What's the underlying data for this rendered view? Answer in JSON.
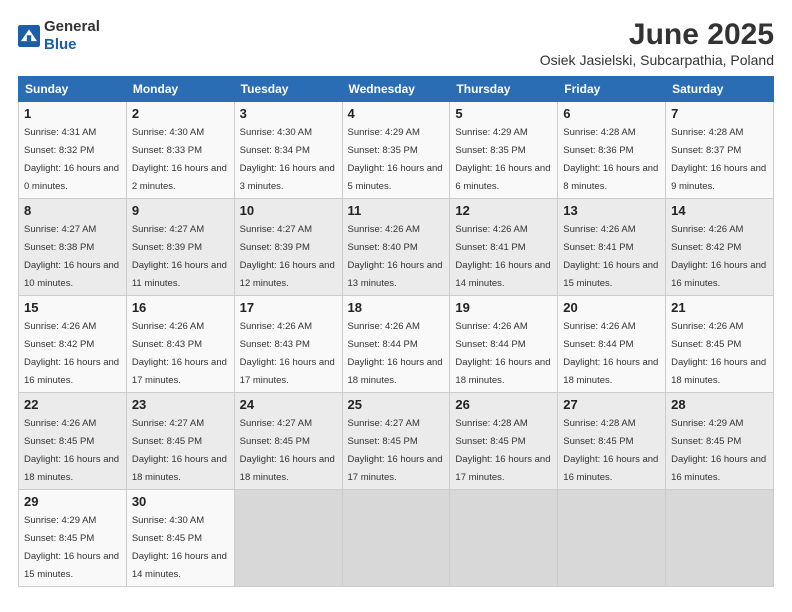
{
  "logo": {
    "general": "General",
    "blue": "Blue"
  },
  "title": "June 2025",
  "subtitle": "Osiek Jasielski, Subcarpathia, Poland",
  "days_header": [
    "Sunday",
    "Monday",
    "Tuesday",
    "Wednesday",
    "Thursday",
    "Friday",
    "Saturday"
  ],
  "weeks": [
    [
      {
        "day": "1",
        "sunrise": "4:31 AM",
        "sunset": "8:32 PM",
        "daylight": "16 hours and 0 minutes."
      },
      {
        "day": "2",
        "sunrise": "4:30 AM",
        "sunset": "8:33 PM",
        "daylight": "16 hours and 2 minutes."
      },
      {
        "day": "3",
        "sunrise": "4:30 AM",
        "sunset": "8:34 PM",
        "daylight": "16 hours and 3 minutes."
      },
      {
        "day": "4",
        "sunrise": "4:29 AM",
        "sunset": "8:35 PM",
        "daylight": "16 hours and 5 minutes."
      },
      {
        "day": "5",
        "sunrise": "4:29 AM",
        "sunset": "8:35 PM",
        "daylight": "16 hours and 6 minutes."
      },
      {
        "day": "6",
        "sunrise": "4:28 AM",
        "sunset": "8:36 PM",
        "daylight": "16 hours and 8 minutes."
      },
      {
        "day": "7",
        "sunrise": "4:28 AM",
        "sunset": "8:37 PM",
        "daylight": "16 hours and 9 minutes."
      }
    ],
    [
      {
        "day": "8",
        "sunrise": "4:27 AM",
        "sunset": "8:38 PM",
        "daylight": "16 hours and 10 minutes."
      },
      {
        "day": "9",
        "sunrise": "4:27 AM",
        "sunset": "8:39 PM",
        "daylight": "16 hours and 11 minutes."
      },
      {
        "day": "10",
        "sunrise": "4:27 AM",
        "sunset": "8:39 PM",
        "daylight": "16 hours and 12 minutes."
      },
      {
        "day": "11",
        "sunrise": "4:26 AM",
        "sunset": "8:40 PM",
        "daylight": "16 hours and 13 minutes."
      },
      {
        "day": "12",
        "sunrise": "4:26 AM",
        "sunset": "8:41 PM",
        "daylight": "16 hours and 14 minutes."
      },
      {
        "day": "13",
        "sunrise": "4:26 AM",
        "sunset": "8:41 PM",
        "daylight": "16 hours and 15 minutes."
      },
      {
        "day": "14",
        "sunrise": "4:26 AM",
        "sunset": "8:42 PM",
        "daylight": "16 hours and 16 minutes."
      }
    ],
    [
      {
        "day": "15",
        "sunrise": "4:26 AM",
        "sunset": "8:42 PM",
        "daylight": "16 hours and 16 minutes."
      },
      {
        "day": "16",
        "sunrise": "4:26 AM",
        "sunset": "8:43 PM",
        "daylight": "16 hours and 17 minutes."
      },
      {
        "day": "17",
        "sunrise": "4:26 AM",
        "sunset": "8:43 PM",
        "daylight": "16 hours and 17 minutes."
      },
      {
        "day": "18",
        "sunrise": "4:26 AM",
        "sunset": "8:44 PM",
        "daylight": "16 hours and 18 minutes."
      },
      {
        "day": "19",
        "sunrise": "4:26 AM",
        "sunset": "8:44 PM",
        "daylight": "16 hours and 18 minutes."
      },
      {
        "day": "20",
        "sunrise": "4:26 AM",
        "sunset": "8:44 PM",
        "daylight": "16 hours and 18 minutes."
      },
      {
        "day": "21",
        "sunrise": "4:26 AM",
        "sunset": "8:45 PM",
        "daylight": "16 hours and 18 minutes."
      }
    ],
    [
      {
        "day": "22",
        "sunrise": "4:26 AM",
        "sunset": "8:45 PM",
        "daylight": "16 hours and 18 minutes."
      },
      {
        "day": "23",
        "sunrise": "4:27 AM",
        "sunset": "8:45 PM",
        "daylight": "16 hours and 18 minutes."
      },
      {
        "day": "24",
        "sunrise": "4:27 AM",
        "sunset": "8:45 PM",
        "daylight": "16 hours and 18 minutes."
      },
      {
        "day": "25",
        "sunrise": "4:27 AM",
        "sunset": "8:45 PM",
        "daylight": "16 hours and 17 minutes."
      },
      {
        "day": "26",
        "sunrise": "4:28 AM",
        "sunset": "8:45 PM",
        "daylight": "16 hours and 17 minutes."
      },
      {
        "day": "27",
        "sunrise": "4:28 AM",
        "sunset": "8:45 PM",
        "daylight": "16 hours and 16 minutes."
      },
      {
        "day": "28",
        "sunrise": "4:29 AM",
        "sunset": "8:45 PM",
        "daylight": "16 hours and 16 minutes."
      }
    ],
    [
      {
        "day": "29",
        "sunrise": "4:29 AM",
        "sunset": "8:45 PM",
        "daylight": "16 hours and 15 minutes."
      },
      {
        "day": "30",
        "sunrise": "4:30 AM",
        "sunset": "8:45 PM",
        "daylight": "16 hours and 14 minutes."
      },
      null,
      null,
      null,
      null,
      null
    ]
  ]
}
